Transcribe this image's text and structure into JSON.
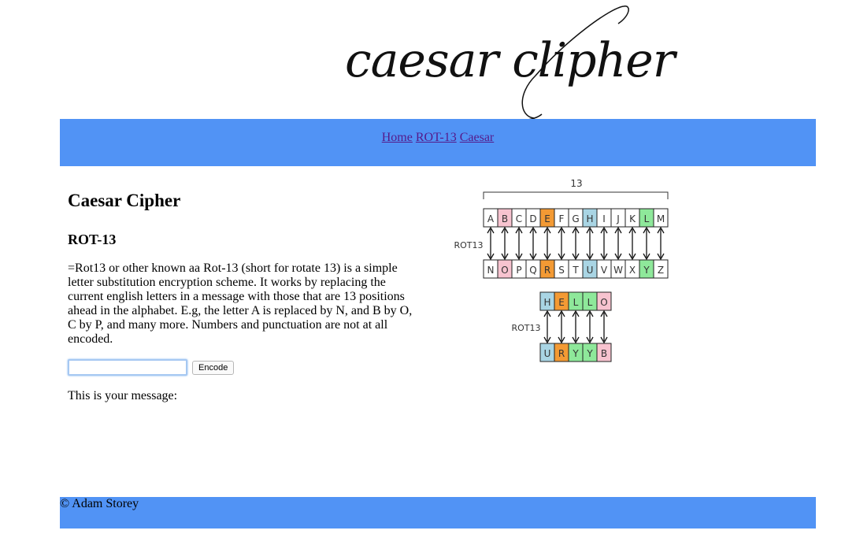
{
  "logo": {
    "text": "caesar clipher"
  },
  "nav": {
    "links": [
      "Home",
      "ROT-13",
      "Caesar"
    ]
  },
  "main": {
    "title": "Caesar Cipher",
    "subtitle": "ROT-13",
    "description": "=Rot13 or other known aa Rot-13 (short for rotate 13) is a simple letter substitution encryption scheme. It works by replacing the current english letters in a message with those that are 13 positions ahead in the alphabet. E.g, the letter A is replaced by N, and B by O, C by P, and many more. Numbers and punctuation are not at all encoded.",
    "input_value": "",
    "encode_label": "Encode",
    "result_label": "This is your message:"
  },
  "diagram": {
    "shift_label": "13",
    "rot_label": "ROT13",
    "top_row": [
      "A",
      "B",
      "C",
      "D",
      "E",
      "F",
      "G",
      "H",
      "I",
      "J",
      "K",
      "L",
      "M"
    ],
    "bottom_row": [
      "N",
      "O",
      "P",
      "Q",
      "R",
      "S",
      "T",
      "U",
      "V",
      "W",
      "X",
      "Y",
      "Z"
    ],
    "top_colors": [
      "#ffffff",
      "#f7c3cf",
      "#ffffff",
      "#ffffff",
      "#f39a34",
      "#ffffff",
      "#ffffff",
      "#a9d5e4",
      "#ffffff",
      "#ffffff",
      "#ffffff",
      "#8ee89a",
      "#ffffff"
    ],
    "bottom_colors": [
      "#ffffff",
      "#f7c3cf",
      "#ffffff",
      "#ffffff",
      "#f39a34",
      "#ffffff",
      "#ffffff",
      "#a9d5e4",
      "#ffffff",
      "#ffffff",
      "#ffffff",
      "#8ee89a",
      "#ffffff"
    ],
    "example_plain": [
      "H",
      "E",
      "L",
      "L",
      "O"
    ],
    "example_cipher": [
      "U",
      "R",
      "Y",
      "Y",
      "B"
    ],
    "example_colors": [
      "#a9d5e4",
      "#f39a34",
      "#8ee89a",
      "#8ee89a",
      "#f7c3cf"
    ]
  },
  "footer": {
    "text": "© Adam Storey"
  }
}
